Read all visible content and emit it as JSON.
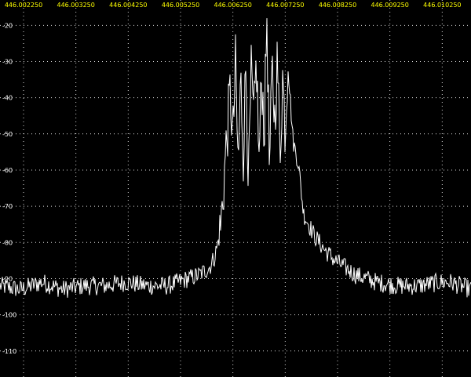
{
  "chart_data": {
    "type": "line",
    "title": "",
    "xlabel": "",
    "ylabel": "",
    "x_ticks": [
      "446.002250",
      "446.003250",
      "446.004250",
      "446.005250",
      "446.006250",
      "446.007250",
      "446.008250",
      "446.009250",
      "446.010250"
    ],
    "x_tick_values": [
      446.00225,
      446.00325,
      446.00425,
      446.00525,
      446.00625,
      446.00725,
      446.00825,
      446.00925,
      446.01025
    ],
    "xlim": [
      446.0018,
      446.0108
    ],
    "y_ticks": [
      "-20",
      "-30",
      "-40",
      "-50",
      "-60",
      "-70",
      "-80",
      "-90",
      "-100",
      "-110"
    ],
    "y_tick_values": [
      -20,
      -30,
      -40,
      -50,
      -60,
      -70,
      -80,
      -90,
      -100,
      -110
    ],
    "ylim": [
      -117.2,
      -13.0
    ],
    "grid": true,
    "colors": {
      "background": "#000000",
      "trace": "#ffffff",
      "grid": "#ffffff",
      "x_tick_text": "#ffff00",
      "y_tick_text": "#ffffff"
    },
    "series": [
      {
        "x": [
          446.0018,
          446.0022,
          446.0026,
          446.003,
          446.0034,
          446.0038,
          446.0042,
          446.0046,
          446.005,
          446.0052,
          446.0054,
          446.0056,
          446.0058,
          446.0059,
          446.006,
          446.00605,
          446.0061,
          446.00615,
          446.0062,
          446.00625,
          446.0063,
          446.00635,
          446.0064,
          446.00645,
          446.0065,
          446.00655,
          446.0066,
          446.00665,
          446.0067,
          446.00675,
          446.0068,
          446.00685,
          446.0069,
          446.00695,
          446.007,
          446.00705,
          446.0071,
          446.00715,
          446.0072,
          446.00725,
          446.0073,
          446.0074,
          446.0075,
          446.0076,
          446.0078,
          446.008,
          446.0082,
          446.0084,
          446.0086,
          446.0088,
          446.009,
          446.0094,
          446.0098,
          446.0102,
          446.0104,
          446.0106,
          446.0108
        ],
        "y": [
          -92,
          -93,
          -91,
          -93,
          -92,
          -92,
          -91,
          -92,
          -92,
          -91,
          -90,
          -89,
          -87,
          -84,
          -78,
          -70,
          -58,
          -48,
          -38,
          -52,
          -31,
          -60,
          -35,
          -55,
          -30,
          -64,
          -34,
          -48,
          -29,
          -58,
          -33,
          -50,
          -17,
          -62,
          -32,
          -46,
          -29,
          -56,
          -34,
          -49,
          -30,
          -52,
          -58,
          -72,
          -78,
          -82,
          -85,
          -87,
          -89,
          -90,
          -91,
          -92,
          -92,
          -91,
          -91,
          -92,
          -93
        ]
      }
    ]
  }
}
